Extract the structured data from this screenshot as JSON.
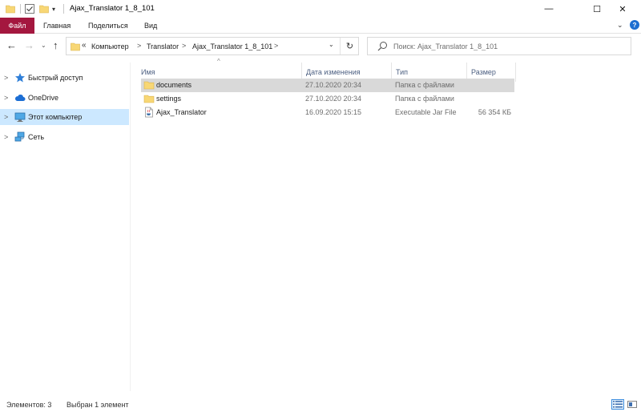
{
  "window": {
    "title": "Ajax_Translator 1_8_101",
    "controls": {
      "minimize": "—",
      "maximize": "☐",
      "close": "✕"
    }
  },
  "quick_access": {
    "icons": [
      "folder-icon",
      "checkbox-properties-icon",
      "new-folder-icon",
      "customize-caret-icon"
    ],
    "caret": "▾"
  },
  "ribbon": {
    "tabs": [
      {
        "label": "Файл",
        "active": true
      },
      {
        "label": "Главная"
      },
      {
        "label": "Поделиться"
      },
      {
        "label": "Вид"
      }
    ],
    "expand": "⌄",
    "help": "?"
  },
  "navigation": {
    "back": "←",
    "forward": "→",
    "recent": "⌄",
    "up": "↑",
    "overflow": "«",
    "breadcrumbs": [
      "Компьютер",
      "Translator",
      "Ajax_Translator 1_8_101"
    ],
    "separator": ">",
    "dropdown": "⌄",
    "refresh": "↻",
    "search_placeholder": "Поиск: Ajax_Translator 1_8_101"
  },
  "sidebar": {
    "items": [
      {
        "label": "Быстрый доступ",
        "icon": "star-icon",
        "chevron": ">"
      },
      {
        "label": "OneDrive",
        "icon": "cloud-icon",
        "chevron": ">"
      },
      {
        "label": "Этот компьютер",
        "icon": "computer-icon",
        "chevron": ">",
        "selected": true
      },
      {
        "label": "Сеть",
        "icon": "network-icon",
        "chevron": ">"
      }
    ]
  },
  "file_list": {
    "sort_indicator": "^",
    "columns": [
      "Имя",
      "Дата изменения",
      "Тип",
      "Размер"
    ],
    "rows": [
      {
        "name": "documents",
        "date": "27.10.2020 20:34",
        "type": "Папка с файлами",
        "size": "",
        "icon": "folder-icon",
        "selected": true
      },
      {
        "name": "settings",
        "date": "27.10.2020 20:34",
        "type": "Папка с файлами",
        "size": "",
        "icon": "folder-icon"
      },
      {
        "name": "Ajax_Translator",
        "date": "16.09.2020 15:15",
        "type": "Executable Jar File",
        "size": "56 354 КБ",
        "icon": "jar-file-icon"
      }
    ]
  },
  "status": {
    "item_count": "Элементов: 3",
    "selection": "Выбран 1 элемент"
  },
  "colors": {
    "file_tab": "#a4173f",
    "selection_blue": "#cce8ff",
    "selection_gray": "#d9d9d9",
    "folder_yellow": "#f8d775",
    "header_text": "#4d6082"
  }
}
